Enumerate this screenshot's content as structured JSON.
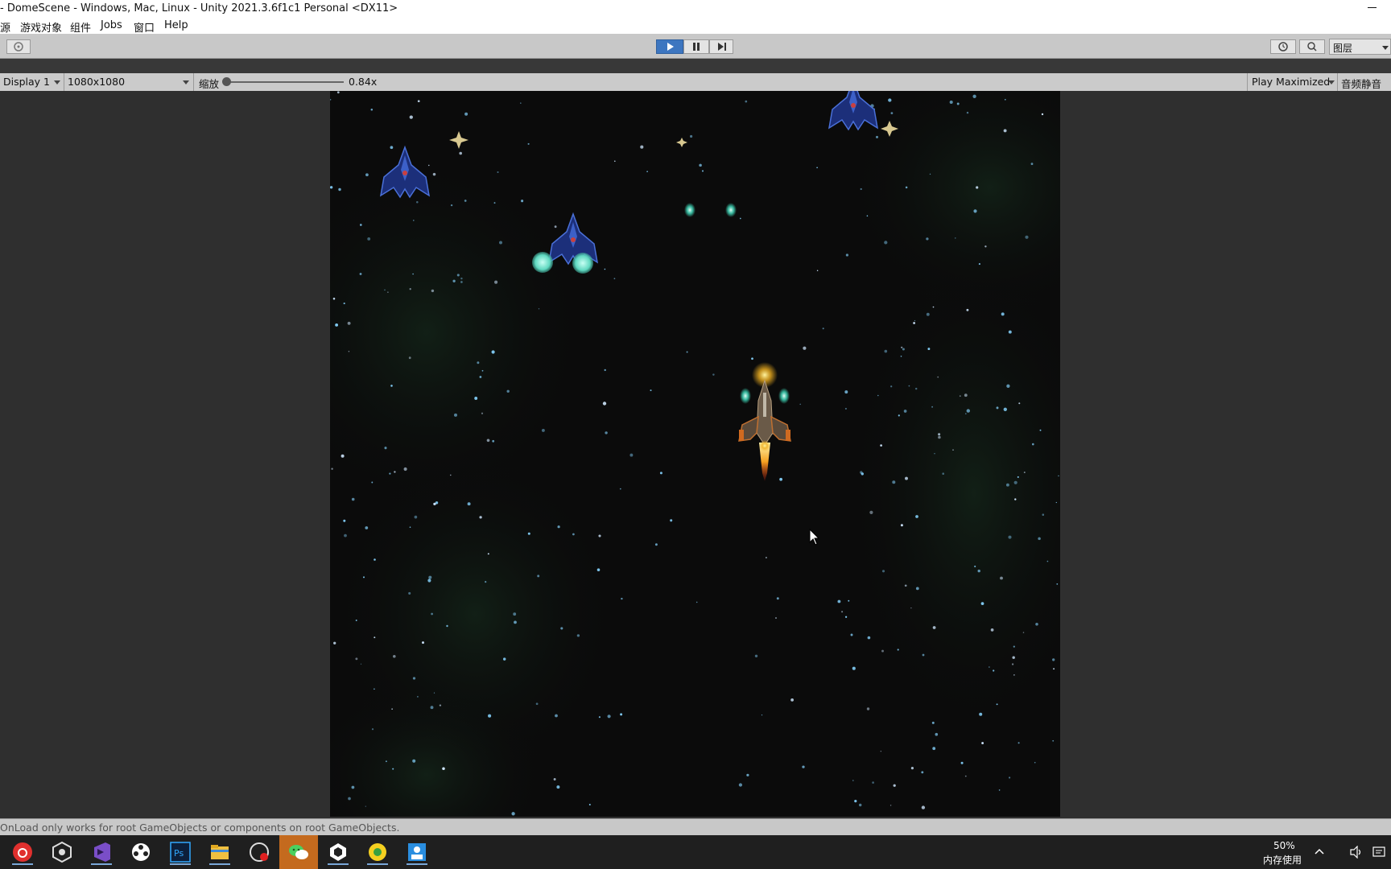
{
  "window": {
    "title": "- DomeScene - Windows, Mac, Linux - Unity 2021.3.6f1c1 Personal <DX11>"
  },
  "menu": {
    "items": [
      "源",
      "游戏对象",
      "组件",
      "Jobs",
      "窗口",
      "Help"
    ]
  },
  "toolbar": {
    "play_icon": "play-icon",
    "pause_icon": "pause-icon",
    "step_icon": "step-icon",
    "history_icon": "history-icon",
    "search_icon": "search-icon",
    "layers_label": "图层",
    "play_active": true
  },
  "game_view": {
    "display_label": "Display 1",
    "resolution_label": "1080x1080",
    "scale_label": "缩放",
    "scale_value": "0.84x",
    "play_mode_label": "Play Maximized",
    "mute_label": "音频静音"
  },
  "status": {
    "message": "OnLoad only works for root GameObjects or components on root GameObjects."
  },
  "taskbar": {
    "apps": [
      "netease-music-icon",
      "unity-hub-icon",
      "visual-studio-icon",
      "video-editor-icon",
      "photoshop-icon",
      "file-explorer-icon",
      "screen-recorder-icon",
      "wechat-icon",
      "unity-editor-icon",
      "browser-icon",
      "photo-viewer-icon"
    ],
    "memory_percent": "50%",
    "memory_label": "内存使用"
  },
  "colors": {
    "accent": "#3d76c0",
    "editor_bg": "#383838",
    "game_bg": "#0b0b0b"
  }
}
